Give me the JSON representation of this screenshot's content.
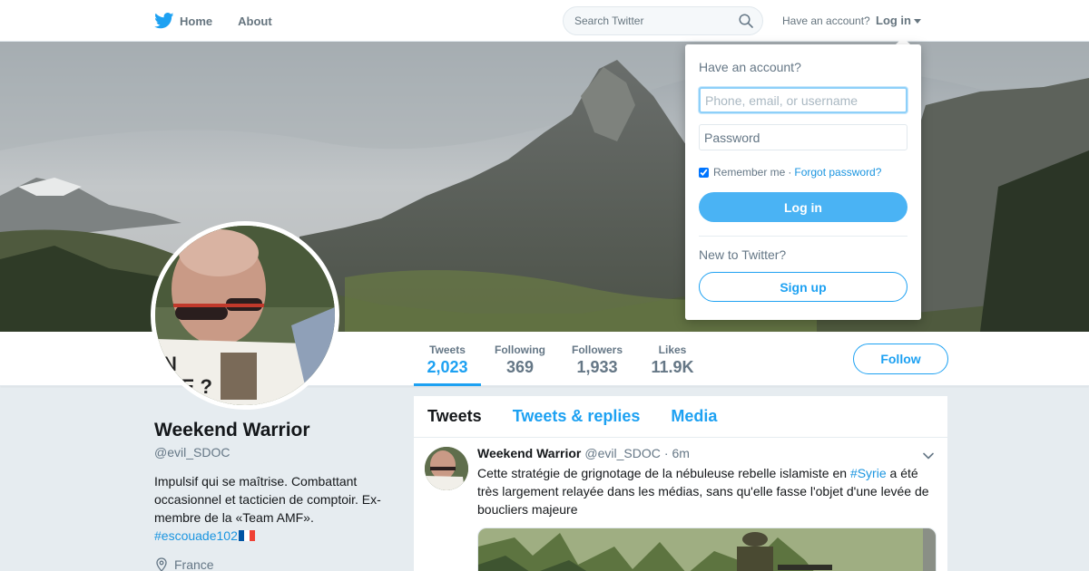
{
  "nav": {
    "home_label": "Home",
    "about_label": "About",
    "search_placeholder": "Search Twitter",
    "have_account": "Have an account?",
    "login_label": "Log in"
  },
  "profile": {
    "name": "Weekend Warrior",
    "handle": "@evil_SDOC",
    "bio": "Impulsif qui se maîtrise. Combattant occasionnel et tacticien de comptoir. Ex-membre de la «Team AMF».",
    "hashtag": "#escouade102",
    "location": "France",
    "follow_label": "Follow"
  },
  "stats": [
    {
      "label": "Tweets",
      "value": "2,023",
      "active": true
    },
    {
      "label": "Following",
      "value": "369",
      "active": false
    },
    {
      "label": "Followers",
      "value": "1,933",
      "active": false
    },
    {
      "label": "Likes",
      "value": "11.9K",
      "active": false
    }
  ],
  "timeline": {
    "tabs": [
      {
        "label": "Tweets",
        "active": true
      },
      {
        "label": "Tweets & replies",
        "active": false
      },
      {
        "label": "Media",
        "active": false
      }
    ],
    "tweet": {
      "name": "Weekend Warrior",
      "handle": "@evil_SDOC",
      "separator": "·",
      "time": "6m",
      "text_before": "Cette stratégie de grignotage de la nébuleuse rebelle islamiste en ",
      "hashtag": "#Syrie",
      "text_after": " a été très largement relayée dans les médias, sans qu'elle fasse l'objet d'une levée de boucliers majeure"
    }
  },
  "login_dropdown": {
    "title": "Have an account?",
    "username_placeholder": "Phone, email, or username",
    "password_placeholder": "Password",
    "remember_label": "Remember me",
    "separator": "·",
    "forgot_label": "Forgot password?",
    "login_button": "Log in",
    "new_label": "New to Twitter?",
    "signup_button": "Sign up"
  },
  "colors": {
    "brand": "#1da1f2",
    "link": "#1b95e0",
    "login_button": "#4ab3f4",
    "muted": "#657786"
  }
}
